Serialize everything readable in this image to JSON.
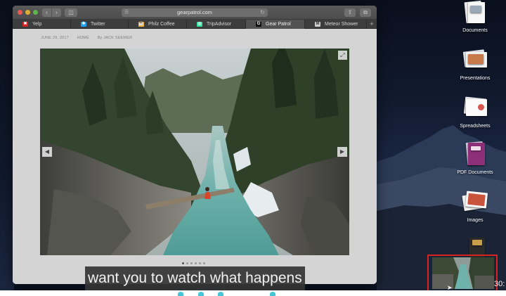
{
  "browser": {
    "url": "gearpatrol.com",
    "tabs": [
      {
        "label": "Yelp",
        "icon": "yelp-icon",
        "color": "#d32323",
        "glyph": "✖"
      },
      {
        "label": "Twitter",
        "icon": "twitter-icon",
        "color": "#1da1f2",
        "glyph": "❖"
      },
      {
        "label": "Philz Coffee",
        "icon": "philz-coffee-icon",
        "color": "#f0b43a",
        "glyph": "☕"
      },
      {
        "label": "TripAdvisor",
        "icon": "tripadvisor-icon",
        "color": "#34e0a1",
        "glyph": "◎"
      },
      {
        "label": "Gear Patrol",
        "icon": "gear-patrol-icon",
        "color": "#111111",
        "glyph": "G"
      },
      {
        "label": "Meteor Shower",
        "icon": "meteor-shower-icon",
        "color": "#cfcfcf",
        "glyph": "M"
      }
    ],
    "active_tab_index": 4,
    "new_tab_symbol": "+"
  },
  "article": {
    "date": "JUNE 29, 2017",
    "section": "HOME",
    "byline": "By JACK SEEMER",
    "gallery": {
      "slide_count": 6,
      "current_slide": 1
    }
  },
  "desktop": {
    "icons": [
      {
        "label": "Documents",
        "icon": "documents-stack-icon"
      },
      {
        "label": "Presentations",
        "icon": "presentations-stack-icon"
      },
      {
        "label": "Spreadsheets",
        "icon": "spreadsheets-stack-icon"
      },
      {
        "label": "PDF Documents",
        "icon": "pdf-documents-stack-icon"
      },
      {
        "label": "Images",
        "icon": "images-stack-icon"
      }
    ]
  },
  "video": {
    "caption": "want you to watch what happens",
    "timecode": "30:",
    "highlight_color": "#d8231f"
  }
}
